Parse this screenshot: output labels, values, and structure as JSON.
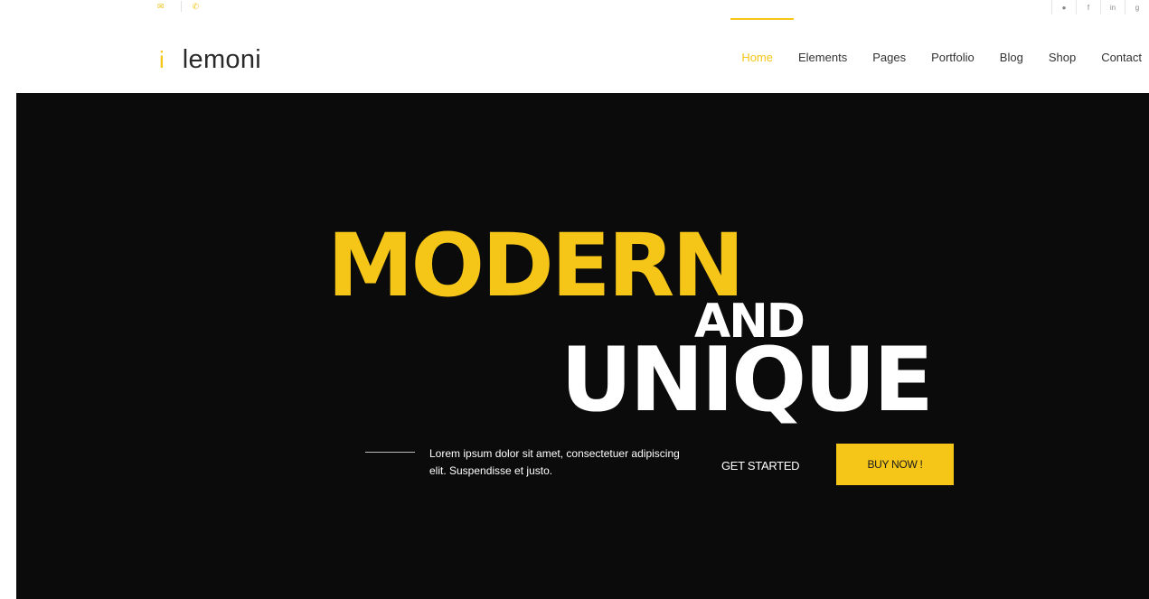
{
  "brand": {
    "name": "lemoni",
    "mark": "i"
  },
  "nav": {
    "items": [
      {
        "label": "Home",
        "active": true
      },
      {
        "label": "Elements"
      },
      {
        "label": "Pages"
      },
      {
        "label": "Portfolio"
      },
      {
        "label": "Blog"
      },
      {
        "label": "Shop"
      },
      {
        "label": "Contact"
      }
    ]
  },
  "hero": {
    "headline_line1": "MODERN",
    "headline_and": "AND",
    "headline_line2": "UNIQUE",
    "description": "Lorem ipsum dolor sit amet, consectetuer adipiscing elit. Suspendisse et justo.",
    "cta_secondary": "GET STARTED",
    "cta_primary": "BUY NOW !"
  },
  "colors": {
    "accent": "#f5c518",
    "hero_bg": "#0b0b0b",
    "text_dark": "#2a2a2a"
  },
  "icons": [
    "mail-icon",
    "phone-icon",
    "twitter-icon",
    "facebook-icon",
    "linkedin-icon",
    "google-plus-icon"
  ]
}
